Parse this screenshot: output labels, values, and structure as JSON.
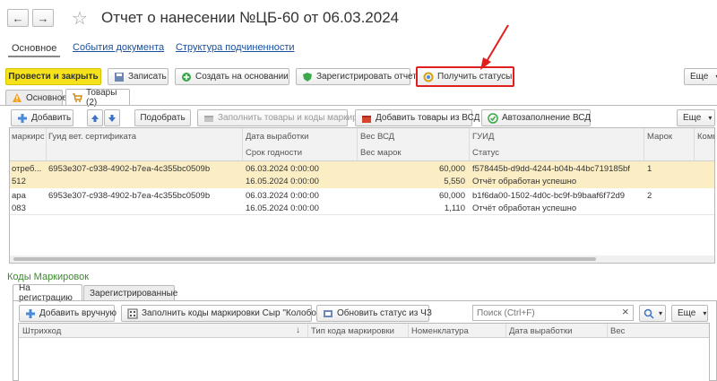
{
  "window": {
    "title": "Отчет о нанесении №ЦБ-60 от 06.03.2024"
  },
  "nav": {
    "back_icon": "←",
    "forward_icon": "→",
    "star_icon": "☆"
  },
  "section_tabs": [
    {
      "label": "Основное"
    },
    {
      "label": "События документа"
    },
    {
      "label": "Структура подчиненности"
    }
  ],
  "toolbar": {
    "post_close": "Провести и закрыть",
    "save": "Записать",
    "create_based": "Создать на основании",
    "register": "Зарегистрировать отчет",
    "get_statuses": "Получить статусы",
    "more": "Еще"
  },
  "form_tabs": [
    {
      "label": "Основное"
    },
    {
      "label": "Товары (2)"
    }
  ],
  "goods_toolbar": {
    "add": "Добавить",
    "select": "Подобрать",
    "fill_codes": "Заполнить товары и коды маркировок",
    "add_vsd": "Добавить товары из ВСД",
    "autofill_vsd": "Автозаполнение ВСД",
    "more": "Еще"
  },
  "goods_table": {
    "headers_row1": [
      "маркиро...",
      "Гуид вет. сертификата",
      "Дата выработки",
      "Вес ВСД",
      "ГУИД",
      "Марок",
      "Комм"
    ],
    "headers_row2": [
      "",
      "",
      "Срок годности",
      "Вес марок",
      "Статус",
      "",
      ""
    ],
    "rows": [
      {
        "line1": [
          "отреб...",
          "6953e307-c938-4902-b7ea-4c355bc0509b",
          "06.03.2024 0:00:00",
          "60,000",
          "f578445b-d9dd-4244-b04b-44bc719185bf",
          "1"
        ],
        "line2": [
          "512",
          "",
          "16.05.2024 0:00:00",
          "5,550",
          "Отчёт обработан успешно",
          ""
        ]
      },
      {
        "line1": [
          "ара",
          "6953e307-c938-4902-b7ea-4c355bc0509b",
          "06.03.2024 0:00:00",
          "60,000",
          "b1f6da00-1502-4d0c-bc9f-b9baaf6f72d9",
          "2"
        ],
        "line2": [
          "083",
          "",
          "16.05.2024 0:00:00",
          "1,110",
          "Отчёт обработан успешно",
          ""
        ]
      }
    ]
  },
  "codes_section": {
    "title": "Коды Маркировок",
    "tabs": [
      {
        "label": "На регистрацию"
      },
      {
        "label": "Зарегистрированные"
      }
    ],
    "add_manual": "Добавить вручную",
    "fill_codes": "Заполнить коды маркировки Сыр \"Колобок\"",
    "refresh_status": "Обновить статус из ЧЗ",
    "search_placeholder": "Поиск (Ctrl+F)",
    "clear_icon": "×",
    "more": "Еще",
    "columns": [
      "Штрихкод",
      "Тип кода маркировки",
      "Номенклатура",
      "Дата выработки",
      "Вес"
    ]
  },
  "colors": {
    "accent_yellow": "#f5e21b",
    "highlight_red": "#e0201e",
    "selected_row": "#fbeec4",
    "link_blue": "#1a4f9c",
    "section_green": "#3a8a2a"
  }
}
